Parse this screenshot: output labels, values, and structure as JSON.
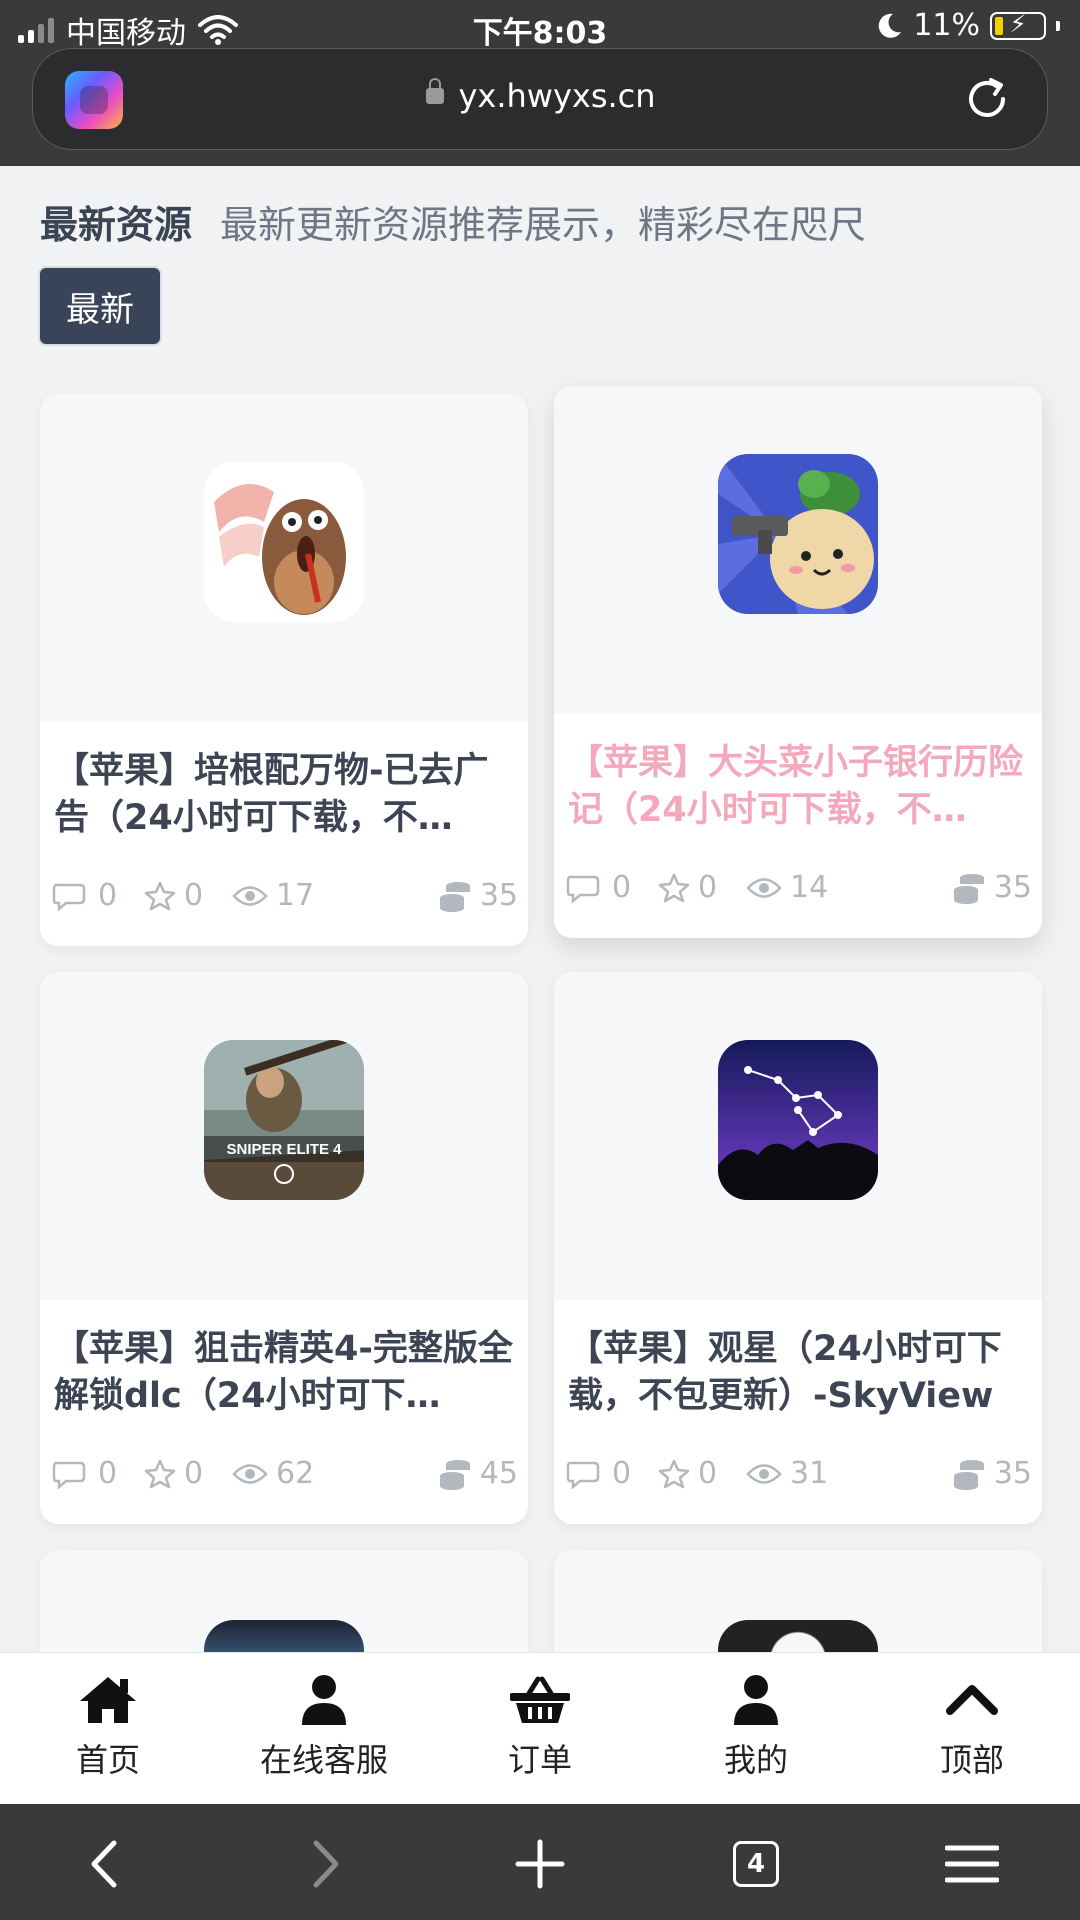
{
  "status_bar": {
    "carrier": "中国移动",
    "time": "下午8:03",
    "battery": "11%"
  },
  "url_bar": {
    "url": "yx.hwyxs.cn"
  },
  "section": {
    "title": "最新资源",
    "subtitle": "最新更新资源推荐展示，精彩尽在咫尺",
    "tab_label": "最新"
  },
  "cards": [
    {
      "title": "【苹果】培根配万物-已去广告（24小时可下载，不…",
      "comments": "0",
      "favorites": "0",
      "views": "17",
      "price": "35",
      "icon": "bacon-game-icon",
      "visited": false
    },
    {
      "title": "【苹果】大头菜小子银行历险记（24小时可下载，不…",
      "comments": "0",
      "favorites": "0",
      "views": "14",
      "price": "35",
      "icon": "turnip-boy-game-icon",
      "visited": true
    },
    {
      "title": "【苹果】狙击精英4-完整版全解锁dlc（24小时可下…",
      "comments": "0",
      "favorites": "0",
      "views": "62",
      "price": "45",
      "icon": "sniper-elite-game-icon",
      "icon_text": "SNIPER ELITE 4",
      "visited": false
    },
    {
      "title": "【苹果】观星（24小时可下载，不包更新）-SkyView",
      "comments": "0",
      "favorites": "0",
      "views": "31",
      "price": "35",
      "icon": "skyview-app-icon",
      "visited": false
    }
  ],
  "bottom_nav": [
    {
      "label": "首页",
      "icon": "home-icon"
    },
    {
      "label": "在线客服",
      "icon": "user-icon"
    },
    {
      "label": "订单",
      "icon": "basket-icon"
    },
    {
      "label": "我的",
      "icon": "user-icon"
    },
    {
      "label": "顶部",
      "icon": "chevron-up-icon"
    }
  ],
  "browser_toolbar": {
    "tab_count": "4"
  },
  "colors": {
    "chrome": "#3a3a3c",
    "tab_active": "#394459",
    "title_text": "#3d4554",
    "visited_title": "#f4a8bc",
    "meta_text": "#b3b8bf"
  }
}
